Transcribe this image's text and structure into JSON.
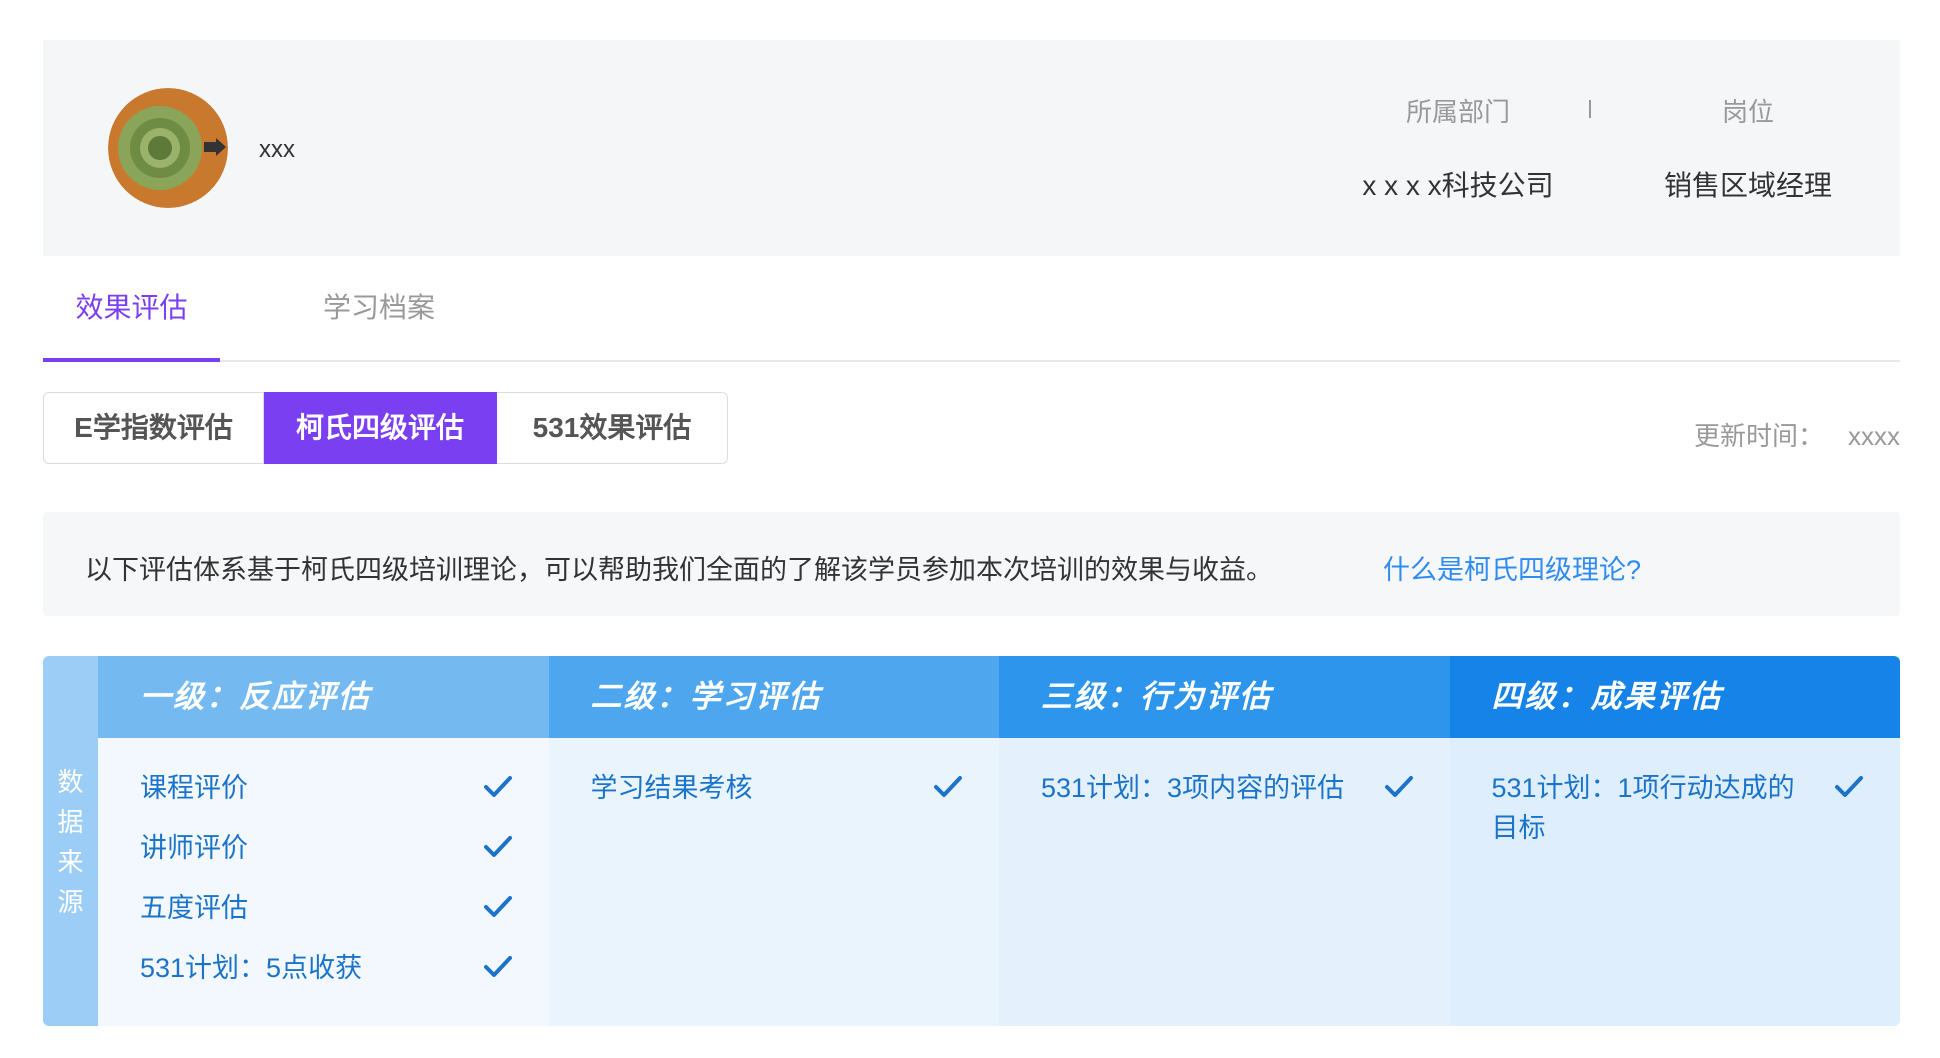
{
  "profile": {
    "name": "xxx",
    "department_label": "所属部门",
    "department_value": "x x x x科技公司",
    "position_label": "岗位",
    "position_value": "销售区域经理"
  },
  "tabs": [
    {
      "label": "效果评估",
      "active": true
    },
    {
      "label": "学习档案",
      "active": false
    }
  ],
  "segments": [
    {
      "label": "E学指数评估",
      "active": false
    },
    {
      "label": "柯氏四级评估",
      "active": true
    },
    {
      "label": "531效果评估",
      "active": false
    }
  ],
  "update": {
    "label": "更新时间：",
    "value": "xxxx"
  },
  "banner": {
    "text": "以下评估体系基于柯氏四级培训理论，可以帮助我们全面的了解该学员参加本次培训的效果与收益。",
    "link": "什么是柯氏四级理论?"
  },
  "source_label": "数据来源",
  "levels": [
    {
      "title": "一级：反应评估",
      "items": [
        "课程评价",
        "讲师评价",
        "五度评估",
        "531计划：5点收获"
      ]
    },
    {
      "title": "二级：学习评估",
      "items": [
        "学习结果考核"
      ]
    },
    {
      "title": "三级：行为评估",
      "items": [
        "531计划：3项内容的评估"
      ]
    },
    {
      "title": "四级：成果评估",
      "items": [
        "531计划：1项行动达成的目标"
      ]
    }
  ],
  "colors": {
    "accent": "#7b3ff2",
    "link": "#2f8cf0",
    "check": "#1b74c9"
  },
  "icons": {
    "check": "check-icon",
    "avatar": "avatar-image"
  }
}
